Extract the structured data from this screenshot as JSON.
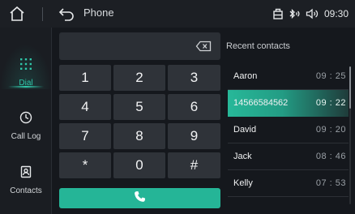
{
  "topbar": {
    "title": "Phone",
    "clock": "09:30",
    "status_icons": [
      "battery-icon",
      "bluetooth-icon",
      "volume-icon"
    ]
  },
  "nav": {
    "items": [
      {
        "label": "Dial",
        "icon": "dialpad-icon",
        "active": true
      },
      {
        "label": "Call Log",
        "icon": "clock-icon",
        "active": false
      },
      {
        "label": "Contacts",
        "icon": "contacts-icon",
        "active": false
      }
    ]
  },
  "dialpad": {
    "entry_value": "",
    "keys": [
      "1",
      "2",
      "3",
      "4",
      "5",
      "6",
      "7",
      "8",
      "9",
      "*",
      "0",
      "#"
    ]
  },
  "recent": {
    "title": "Recent contacts",
    "rows": [
      {
        "name": "Aaron",
        "time": "09 : 25",
        "active": false
      },
      {
        "name": "14566584562",
        "time": "09 : 22",
        "active": true
      },
      {
        "name": "David",
        "time": "09 : 20",
        "active": false
      },
      {
        "name": "Jack",
        "time": "08 : 46",
        "active": false
      },
      {
        "name": "Kelly",
        "time": "07 : 53",
        "active": false
      }
    ]
  },
  "colors": {
    "accent": "#2fc7a9",
    "call_button": "#25b597",
    "background": "#15181d"
  }
}
